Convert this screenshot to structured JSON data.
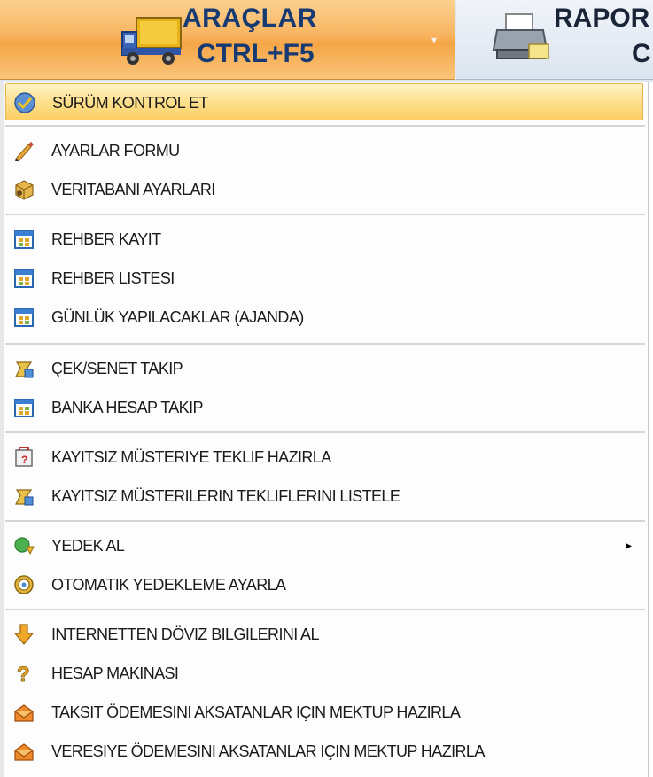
{
  "tabs": {
    "araclar": {
      "line1": "ARAÇLAR",
      "line2": "CTRL+F5",
      "dropdown": "▾"
    },
    "rapor": {
      "line1": "RAPOR",
      "line2": "C"
    }
  },
  "menu": {
    "submenu_arrow": "▸",
    "items": [
      {
        "label": "SÜRÜM KONTROL ET",
        "icon": "version-check-icon"
      },
      {
        "label": "AYARLAR FORMU",
        "icon": "pencil-icon"
      },
      {
        "label": "VERITABANI AYARLARI",
        "icon": "database-icon"
      },
      {
        "label": "REHBER KAYIT",
        "icon": "contact-card-icon"
      },
      {
        "label": "REHBER LISTESI",
        "icon": "contact-card-icon"
      },
      {
        "label": "GÜNLÜK YAPILACAKLAR (AJANDA)",
        "icon": "calendar-icon"
      },
      {
        "label": "ÇEK/SENET TAKIP",
        "icon": "money-bag-icon"
      },
      {
        "label": "BANKA HESAP TAKIP",
        "icon": "calendar-icon"
      },
      {
        "label": "KAYITSIZ MÜSTERIYE TEKLIF HAZIRLA",
        "icon": "quote-icon"
      },
      {
        "label": "KAYITSIZ MÜSTERILERIN TEKLIFLERINI LISTELE",
        "icon": "money-bag-icon"
      },
      {
        "label": "YEDEK AL",
        "icon": "backup-icon"
      },
      {
        "label": "OTOMATIK YEDEKLEME AYARLA",
        "icon": "gear-icon"
      },
      {
        "label": "INTERNETTEN DÖVIZ BILGILERINI AL",
        "icon": "download-arrow-icon"
      },
      {
        "label": "HESAP MAKINASI",
        "icon": "question-icon"
      },
      {
        "label": "TAKSIT ÖDEMESINI  AKSATANLAR IÇIN MEKTUP HAZIRLA",
        "icon": "envelope-icon"
      },
      {
        "label": "VERESIYE ÖDEMESINI  AKSATANLAR IÇIN MEKTUP HAZIRLA",
        "icon": "envelope-icon"
      }
    ]
  }
}
